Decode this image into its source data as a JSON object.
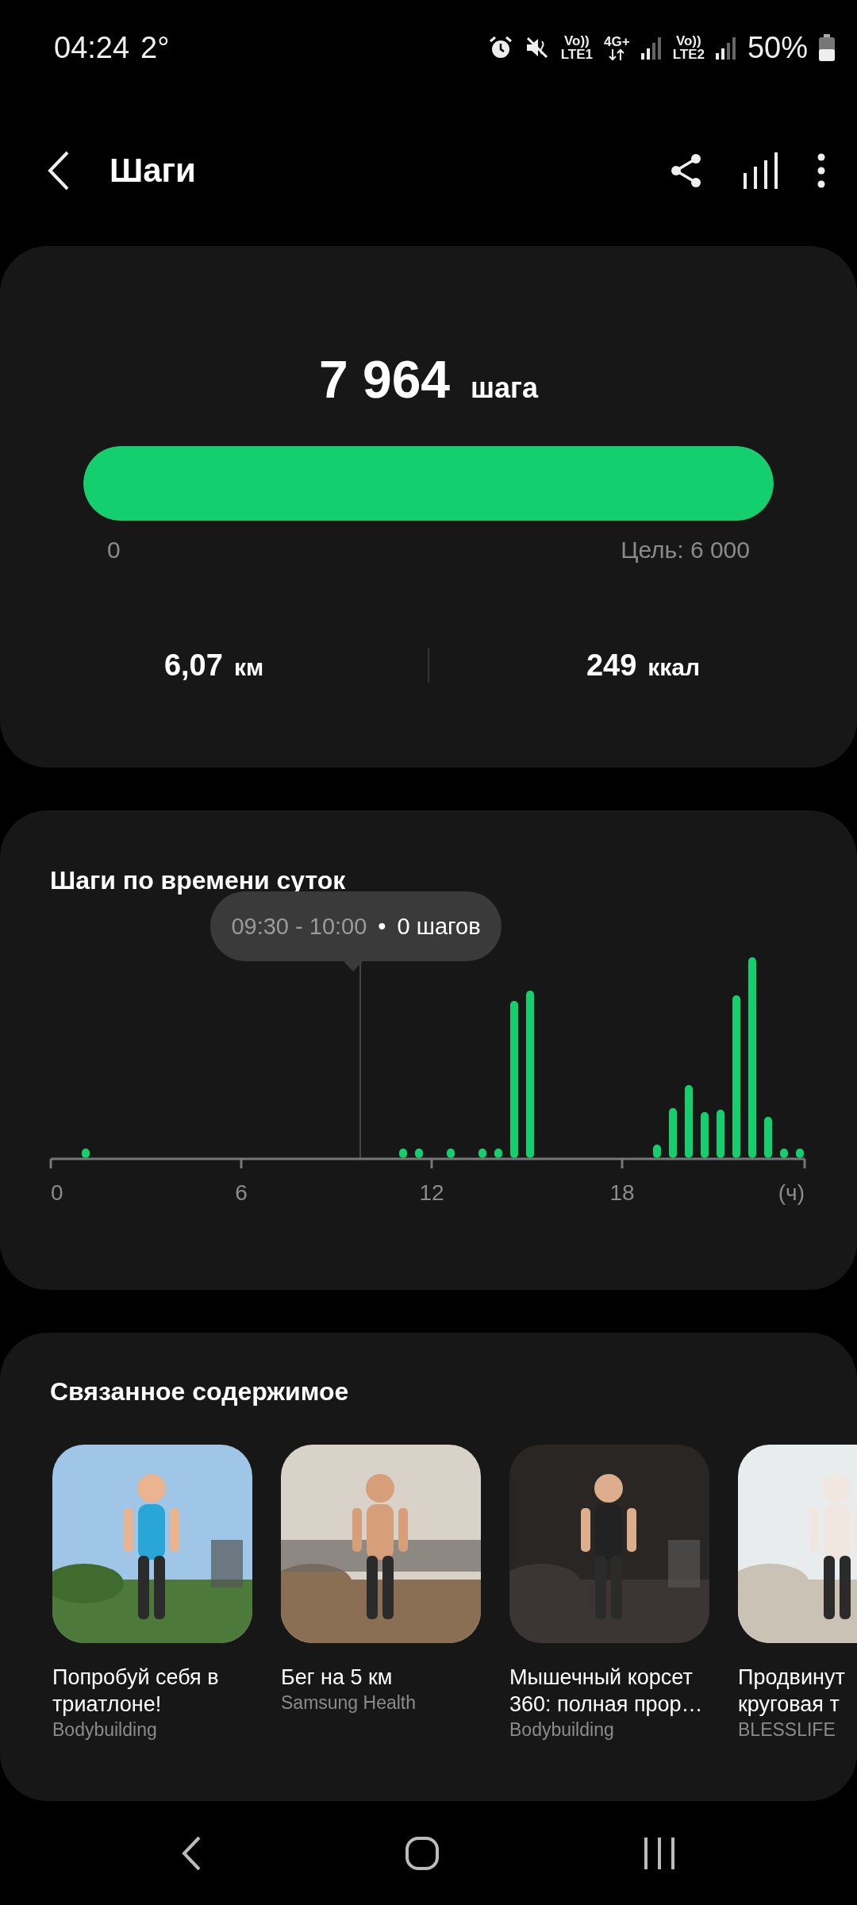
{
  "status_bar": {
    "time": "04:24",
    "temperature": "2°",
    "sim1_voice": "Vo))",
    "sim1_network": "LTE1",
    "data_type": "4G+",
    "sim2_voice": "Vo))",
    "sim2_network": "LTE2",
    "battery": "50%"
  },
  "header": {
    "title": "Шаги"
  },
  "summary": {
    "steps": "7 964",
    "steps_unit": "шага",
    "level": 1,
    "min_label": "0",
    "goal_label": "Цель: 6 000",
    "distance": "6,07",
    "distance_unit": "км",
    "calories": "249",
    "calories_unit": "ккал"
  },
  "hourly": {
    "title": "Шаги по времени суток",
    "tooltip_time": "09:30 - 10:00",
    "tooltip_bullet": "•",
    "tooltip_value": "0 шагов",
    "x_ticks": [
      "0",
      "6",
      "12",
      "18",
      "(ч)"
    ]
  },
  "related": {
    "title": "Связанное содержимое",
    "items": [
      {
        "title": "Попробуй себя в триатлоне!",
        "source": "Bodybuilding",
        "kind": "picture"
      },
      {
        "title": "Бег на 5 км",
        "source": "Samsung Health",
        "kind": "picture"
      },
      {
        "title": "Мышечный корсет 360: полная прор…",
        "source": "Bodybuilding",
        "kind": "picture"
      },
      {
        "title": "Продвинут\nкруговая т",
        "source": "BLESSLIFE",
        "kind": "picture"
      }
    ]
  }
}
